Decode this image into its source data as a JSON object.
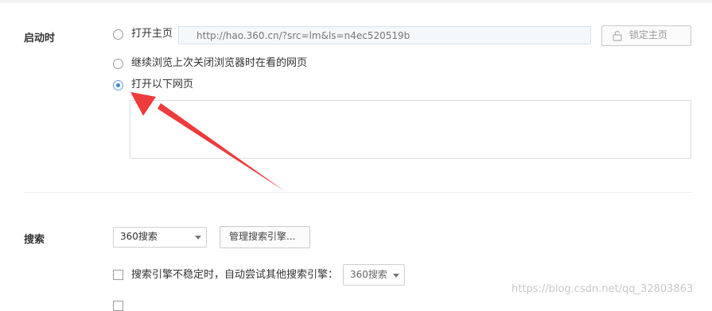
{
  "startup": {
    "section_label": "启动时",
    "options": [
      {
        "label": "打开主页",
        "checked": false
      },
      {
        "label": "继续浏览上次关闭浏览器时在看的网页",
        "checked": false
      },
      {
        "label": "打开以下网页",
        "checked": true
      }
    ],
    "homepage_url": "http://hao.360.cn/?src=lm&ls=n4ec520519b",
    "lock_label": "锁定主页"
  },
  "search": {
    "section_label": "搜索",
    "engine_selected": "360搜索",
    "manage_label": "管理搜索引擎...",
    "fallback_label": "搜索引擎不稳定时，自动尝试其他搜索引擎：",
    "fallback_engine": "360搜索"
  },
  "watermark": "https://blog.csdn.net/qq_32803863",
  "colors": {
    "arrow": "#ee3b3b",
    "radio_checked": "#3b86d9",
    "url_bg": "#f4f8fb"
  }
}
